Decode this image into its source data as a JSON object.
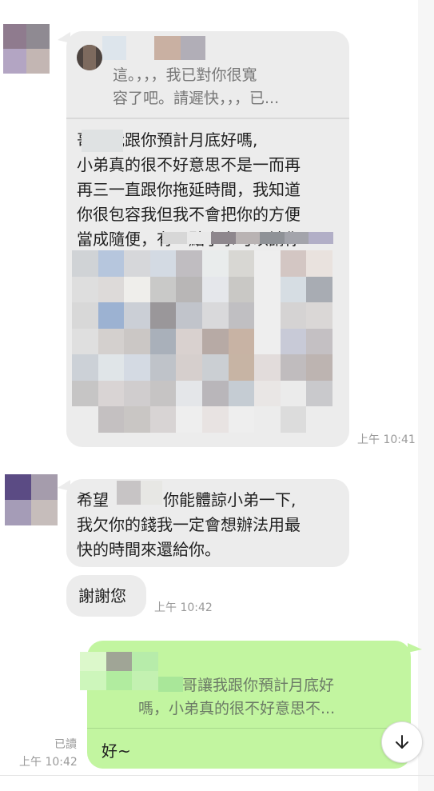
{
  "messages": {
    "m1": {
      "quote_text": "這。，，，我已對你很寬容了吧。請遲快，，，已...",
      "quote_line1": "這。，，，我已對你很寬",
      "quote_line2": "容了吧。請遲快，，，已...",
      "body_lines": [
        "哥讓我跟你預計月底好嗎,",
        "小弟真的很不好意思不是一而再",
        "再三一直跟你拖延時間，我知道",
        "你很包容我但我不會把你的方便",
        "當成隨便，有一點小事可以請你"
      ],
      "time": "上午 10:41"
    },
    "m2": {
      "body_lines": [
        "希望哥可以你能體諒小弟一下,",
        "我欠你的錢我一定會想辦法用最",
        "快的時間來還給你。"
      ],
      "line1_prefix": "希望",
      "line1_suffix": "你能體諒小弟一下,",
      "line2": "我欠你的錢我一定會想辦法用最",
      "line3": "快的時間來還給你。"
    },
    "m3": {
      "text": "謝謝您",
      "time": "上午 10:42"
    },
    "m4": {
      "quote_line1": "哥讓我跟你預計月底好",
      "quote_line2": "嗎，小弟真的很不好意思不...",
      "reply": "好~",
      "read_label": "已讀",
      "time": "上午 10:42"
    }
  },
  "icons": {
    "scroll_down": "arrow-down-icon"
  },
  "colors": {
    "incoming_bubble": "#ececec",
    "outgoing_bubble": "#c2f5a0",
    "time_text": "#9a9a9a"
  }
}
